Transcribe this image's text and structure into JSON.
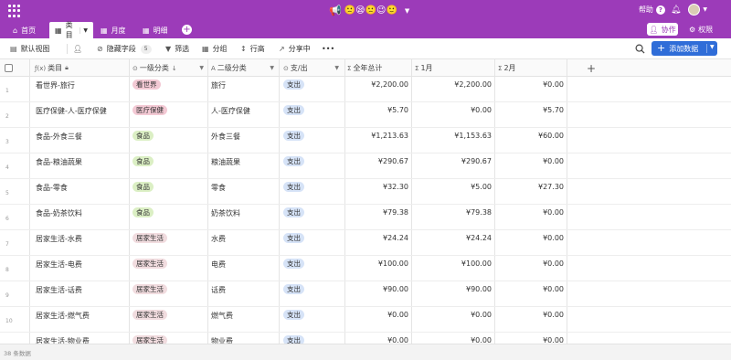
{
  "app": {
    "title_emoji": "🙁😪🙁😉🙂",
    "help_label": "帮助",
    "help_q": "?",
    "menu_icon": "grid-menu-icon"
  },
  "tabs": [
    {
      "label": "首页",
      "icon": "home-icon"
    },
    {
      "label": "类目",
      "icon": "table-icon",
      "active": true
    },
    {
      "label": "月度",
      "icon": "table-icon"
    },
    {
      "label": "明细",
      "icon": "table-icon"
    }
  ],
  "header_actions": {
    "collab_label": "协作",
    "permission_label": "权限"
  },
  "toolbar": {
    "view_label": "默认视图",
    "hide_fields_label": "隐藏字段",
    "hide_fields_count": "5",
    "filter_label": "筛选",
    "group_label": "分组",
    "row_height_label": "行高",
    "share_label": "分享中",
    "more_label": "•••",
    "add_record_label": "添加数据"
  },
  "columns": [
    {
      "label": "类目",
      "icon": "ƒ(x)"
    },
    {
      "label": "一级分类",
      "icon": "⊙"
    },
    {
      "label": "二级分类",
      "icon": "A"
    },
    {
      "label": "支/出",
      "icon": "⊙"
    },
    {
      "label": "全年总计",
      "icon": "Σ"
    },
    {
      "label": "1月",
      "icon": "Σ"
    },
    {
      "label": "2月",
      "icon": "Σ"
    }
  ],
  "rows": [
    {
      "n": "1",
      "name": "看世界-旅行",
      "cat": "看世界",
      "sub": "旅行",
      "dir": "支出",
      "total": "¥2,200.00",
      "m1": "¥2,200.00",
      "m2": "¥0.00"
    },
    {
      "n": "2",
      "name": "医疗保健-人-医疗保健",
      "cat": "医疗保健",
      "sub": "人-医疗保健",
      "dir": "支出",
      "total": "¥5.70",
      "m1": "¥0.00",
      "m2": "¥5.70"
    },
    {
      "n": "3",
      "name": "食品-外食三餐",
      "cat": "食品",
      "sub": "外食三餐",
      "dir": "支出",
      "total": "¥1,213.63",
      "m1": "¥1,153.63",
      "m2": "¥60.00"
    },
    {
      "n": "4",
      "name": "食品-粮油蔬果",
      "cat": "食品",
      "sub": "粮油蔬果",
      "dir": "支出",
      "total": "¥290.67",
      "m1": "¥290.67",
      "m2": "¥0.00"
    },
    {
      "n": "5",
      "name": "食品-零食",
      "cat": "食品",
      "sub": "零食",
      "dir": "支出",
      "total": "¥32.30",
      "m1": "¥5.00",
      "m2": "¥27.30"
    },
    {
      "n": "6",
      "name": "食品-奶茶饮料",
      "cat": "食品",
      "sub": "奶茶饮料",
      "dir": "支出",
      "total": "¥79.38",
      "m1": "¥79.38",
      "m2": "¥0.00"
    },
    {
      "n": "7",
      "name": "居家生活-水费",
      "cat": "居家生活",
      "sub": "水费",
      "dir": "支出",
      "total": "¥24.24",
      "m1": "¥24.24",
      "m2": "¥0.00"
    },
    {
      "n": "8",
      "name": "居家生活-电费",
      "cat": "居家生活",
      "sub": "电费",
      "dir": "支出",
      "total": "¥100.00",
      "m1": "¥100.00",
      "m2": "¥0.00"
    },
    {
      "n": "9",
      "name": "居家生活-话费",
      "cat": "居家生活",
      "sub": "话费",
      "dir": "支出",
      "total": "¥90.00",
      "m1": "¥90.00",
      "m2": "¥0.00"
    },
    {
      "n": "10",
      "name": "居家生活-燃气费",
      "cat": "居家生活",
      "sub": "燃气费",
      "dir": "支出",
      "total": "¥0.00",
      "m1": "¥0.00",
      "m2": "¥0.00"
    },
    {
      "n": "11",
      "name": "居家生活-物业费",
      "cat": "居家生活",
      "sub": "物业费",
      "dir": "支出",
      "total": "¥0.00",
      "m1": "¥0.00",
      "m2": "¥0.00"
    }
  ],
  "tag_colors": {
    "看世界": "#f3c9d4",
    "医疗保健": "#f3c9d4",
    "食品": "#dbefc4",
    "居家生活": "#f1dcdf",
    "支出": "#d6e3f7"
  },
  "footer": {
    "record_count": "38 条数据"
  },
  "colors": {
    "brand": "#9c3bb9",
    "primary_button": "#2f6dd8"
  }
}
